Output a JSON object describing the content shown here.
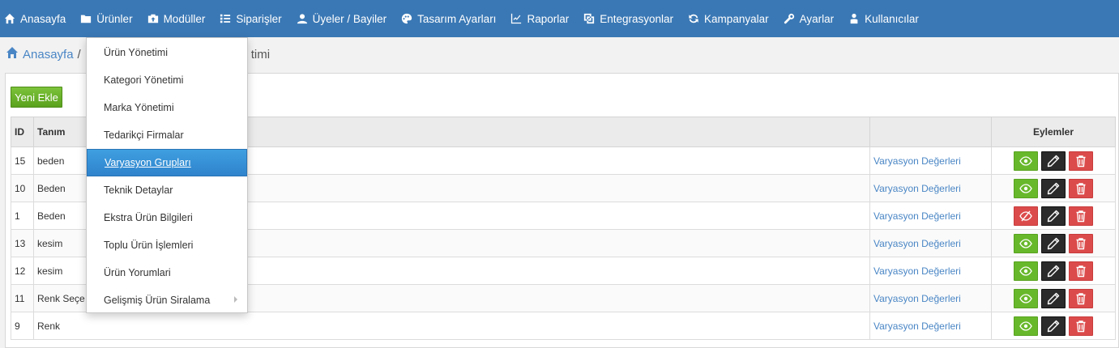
{
  "nav": {
    "items": [
      {
        "label": "Anasayfa",
        "icon": "home-icon"
      },
      {
        "label": "Ürünler",
        "icon": "folder-icon"
      },
      {
        "label": "Modüller",
        "icon": "module-icon"
      },
      {
        "label": "Siparişler",
        "icon": "list-icon"
      },
      {
        "label": "Üyeler / Bayiler",
        "icon": "user-icon"
      },
      {
        "label": "Tasarım Ayarları",
        "icon": "palette-icon"
      },
      {
        "label": "Raporlar",
        "icon": "chart-icon"
      },
      {
        "label": "Entegrasyonlar",
        "icon": "integration-icon"
      },
      {
        "label": "Kampanyalar",
        "icon": "refresh-icon"
      },
      {
        "label": "Ayarlar",
        "icon": "wrench-icon"
      },
      {
        "label": "Kullanıcılar",
        "icon": "users-icon"
      }
    ]
  },
  "breadcrumb": {
    "home": "Anasayfa",
    "separator": "/",
    "current_partial": "timi"
  },
  "toolbar": {
    "add_label": "Yeni Ekle"
  },
  "table": {
    "headers": {
      "id": "ID",
      "name": "Tanım",
      "values": "",
      "actions": "Eylemler"
    },
    "rows": [
      {
        "id": "15",
        "name": "beden",
        "link": "Varyasyon Değerleri",
        "visible": true
      },
      {
        "id": "10",
        "name": "Beden",
        "link": "Varyasyon Değerleri",
        "visible": true
      },
      {
        "id": "1",
        "name": "Beden",
        "link": "Varyasyon Değerleri",
        "visible": false
      },
      {
        "id": "13",
        "name": "kesim",
        "link": "Varyasyon Değerleri",
        "visible": true
      },
      {
        "id": "12",
        "name": "kesim",
        "link": "Varyasyon Değerleri",
        "visible": true
      },
      {
        "id": "11",
        "name": "Renk Seçe",
        "link": "Varyasyon Değerleri",
        "visible": true
      },
      {
        "id": "9",
        "name": "Renk",
        "link": "Varyasyon Değerleri",
        "visible": true
      }
    ]
  },
  "dropdown": {
    "items": [
      {
        "label": "Ürün Yönetimi"
      },
      {
        "label": "Kategori Yönetimi"
      },
      {
        "label": "Marka Yönetimi"
      },
      {
        "label": "Tedarikçi Firmalar"
      },
      {
        "label": "Varyasyon Grupları",
        "selected": true
      },
      {
        "label": "Teknik Detaylar"
      },
      {
        "label": "Ekstra Ürün Bilgileri"
      },
      {
        "label": "Toplu Ürün İşlemleri"
      },
      {
        "label": "Ürün Yorumlari"
      },
      {
        "label": "Gelişmiş Ürün Siralama",
        "submenu": true
      }
    ]
  },
  "colors": {
    "nav_bg": "#3a78b5",
    "link": "#4a86c5",
    "view_green": "#68b82b",
    "delete_red": "#dc4b4b",
    "edit_black": "#2b2b2b",
    "selected_blue": "#2f83cc"
  }
}
